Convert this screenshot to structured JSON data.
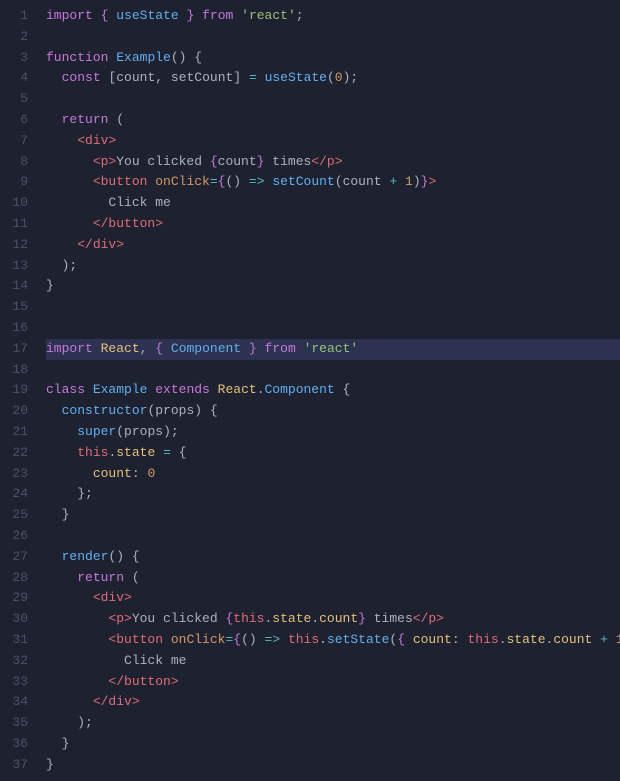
{
  "editor": {
    "background": "#1e2130",
    "highlighted_line": 17,
    "lines": [
      {
        "num": 1,
        "tokens": [
          {
            "type": "kw",
            "text": "import"
          },
          {
            "type": "plain",
            "text": " "
          },
          {
            "type": "brace",
            "text": "{"
          },
          {
            "type": "plain",
            "text": " "
          },
          {
            "type": "fn",
            "text": "useState"
          },
          {
            "type": "plain",
            "text": " "
          },
          {
            "type": "brace",
            "text": "}"
          },
          {
            "type": "plain",
            "text": " "
          },
          {
            "type": "from-kw",
            "text": "from"
          },
          {
            "type": "plain",
            "text": " "
          },
          {
            "type": "str",
            "text": "'react'"
          },
          {
            "type": "semi",
            "text": ";"
          }
        ]
      },
      {
        "num": 2,
        "tokens": []
      },
      {
        "num": 3,
        "tokens": [
          {
            "type": "kw",
            "text": "function"
          },
          {
            "type": "plain",
            "text": " "
          },
          {
            "type": "fn",
            "text": "Example"
          },
          {
            "type": "punct",
            "text": "() {"
          }
        ]
      },
      {
        "num": 4,
        "tokens": [
          {
            "type": "plain",
            "text": "  "
          },
          {
            "type": "kw",
            "text": "const"
          },
          {
            "type": "plain",
            "text": " "
          },
          {
            "type": "bracket",
            "text": "["
          },
          {
            "type": "plain",
            "text": "count"
          },
          {
            "type": "comma",
            "text": ","
          },
          {
            "type": "plain",
            "text": " "
          },
          {
            "type": "plain",
            "text": "setCount"
          },
          {
            "type": "bracket",
            "text": "]"
          },
          {
            "type": "plain",
            "text": " "
          },
          {
            "type": "operator",
            "text": "="
          },
          {
            "type": "plain",
            "text": " "
          },
          {
            "type": "fn",
            "text": "useState"
          },
          {
            "type": "paren",
            "text": "("
          },
          {
            "type": "num",
            "text": "0"
          },
          {
            "type": "paren",
            "text": ")"
          },
          {
            "type": "semi",
            "text": ";"
          }
        ]
      },
      {
        "num": 5,
        "tokens": []
      },
      {
        "num": 6,
        "tokens": [
          {
            "type": "plain",
            "text": "  "
          },
          {
            "type": "kw",
            "text": "return"
          },
          {
            "type": "plain",
            "text": " ("
          }
        ]
      },
      {
        "num": 7,
        "tokens": [
          {
            "type": "plain",
            "text": "    "
          },
          {
            "type": "jsx-tag",
            "text": "<div>"
          }
        ]
      },
      {
        "num": 8,
        "tokens": [
          {
            "type": "plain",
            "text": "      "
          },
          {
            "type": "jsx-tag",
            "text": "<p>"
          },
          {
            "type": "plain",
            "text": "You clicked "
          },
          {
            "type": "brace",
            "text": "{"
          },
          {
            "type": "plain",
            "text": "count"
          },
          {
            "type": "brace",
            "text": "}"
          },
          {
            "type": "plain",
            "text": " times"
          },
          {
            "type": "jsx-tag",
            "text": "</p>"
          }
        ]
      },
      {
        "num": 9,
        "tokens": [
          {
            "type": "plain",
            "text": "      "
          },
          {
            "type": "jsx-tag",
            "text": "<button"
          },
          {
            "type": "plain",
            "text": " "
          },
          {
            "type": "jsx-attr",
            "text": "onClick"
          },
          {
            "type": "operator",
            "text": "="
          },
          {
            "type": "brace",
            "text": "{"
          },
          {
            "type": "paren",
            "text": "("
          },
          {
            "type": "paren",
            "text": ")"
          },
          {
            "type": "plain",
            "text": " "
          },
          {
            "type": "arrow",
            "text": "=>"
          },
          {
            "type": "plain",
            "text": " "
          },
          {
            "type": "fn",
            "text": "setCount"
          },
          {
            "type": "paren",
            "text": "("
          },
          {
            "type": "plain",
            "text": "count "
          },
          {
            "type": "operator",
            "text": "+"
          },
          {
            "type": "plain",
            "text": " "
          },
          {
            "type": "num",
            "text": "1"
          },
          {
            "type": "paren",
            "text": ")"
          },
          {
            "type": "brace",
            "text": "}"
          },
          {
            "type": "jsx-tag",
            "text": ">"
          }
        ]
      },
      {
        "num": 10,
        "tokens": [
          {
            "type": "plain",
            "text": "        Click me"
          }
        ]
      },
      {
        "num": 11,
        "tokens": [
          {
            "type": "plain",
            "text": "      "
          },
          {
            "type": "jsx-tag",
            "text": "</button>"
          }
        ]
      },
      {
        "num": 12,
        "tokens": [
          {
            "type": "plain",
            "text": "    "
          },
          {
            "type": "jsx-tag",
            "text": "</div>"
          }
        ]
      },
      {
        "num": 13,
        "tokens": [
          {
            "type": "plain",
            "text": "  );"
          }
        ]
      },
      {
        "num": 14,
        "tokens": [
          {
            "type": "plain",
            "text": "}"
          }
        ]
      },
      {
        "num": 15,
        "tokens": []
      },
      {
        "num": 16,
        "tokens": []
      },
      {
        "num": 17,
        "tokens": [
          {
            "type": "kw",
            "text": "import"
          },
          {
            "type": "plain",
            "text": " "
          },
          {
            "type": "react-name",
            "text": "React"
          },
          {
            "type": "comma",
            "text": ","
          },
          {
            "type": "plain",
            "text": " "
          },
          {
            "type": "brace",
            "text": "{"
          },
          {
            "type": "plain",
            "text": " "
          },
          {
            "type": "fn",
            "text": "Component"
          },
          {
            "type": "plain",
            "text": " "
          },
          {
            "type": "brace",
            "text": "}"
          },
          {
            "type": "plain",
            "text": " "
          },
          {
            "type": "from-kw",
            "text": "from"
          },
          {
            "type": "plain",
            "text": " "
          },
          {
            "type": "str",
            "text": "'react'"
          }
        ],
        "highlighted": true
      },
      {
        "num": 18,
        "tokens": []
      },
      {
        "num": 19,
        "tokens": [
          {
            "type": "kw",
            "text": "class"
          },
          {
            "type": "plain",
            "text": " "
          },
          {
            "type": "fn",
            "text": "Example"
          },
          {
            "type": "plain",
            "text": " "
          },
          {
            "type": "kw",
            "text": "extends"
          },
          {
            "type": "plain",
            "text": " "
          },
          {
            "type": "react-name",
            "text": "React"
          },
          {
            "type": "punct",
            "text": "."
          },
          {
            "type": "fn",
            "text": "Component"
          },
          {
            "type": "plain",
            "text": " {"
          }
        ]
      },
      {
        "num": 20,
        "tokens": [
          {
            "type": "plain",
            "text": "  "
          },
          {
            "type": "fn",
            "text": "constructor"
          },
          {
            "type": "paren",
            "text": "("
          },
          {
            "type": "plain",
            "text": "props"
          },
          {
            "type": "paren",
            "text": ")"
          },
          {
            "type": "plain",
            "text": " {"
          }
        ]
      },
      {
        "num": 21,
        "tokens": [
          {
            "type": "plain",
            "text": "    "
          },
          {
            "type": "super-fn",
            "text": "super"
          },
          {
            "type": "paren",
            "text": "("
          },
          {
            "type": "plain",
            "text": "props"
          },
          {
            "type": "paren",
            "text": ")"
          },
          {
            "type": "semi",
            "text": ";"
          }
        ]
      },
      {
        "num": 22,
        "tokens": [
          {
            "type": "plain",
            "text": "    "
          },
          {
            "type": "this-kw",
            "text": "this"
          },
          {
            "type": "punct",
            "text": "."
          },
          {
            "type": "state-prop",
            "text": "state"
          },
          {
            "type": "plain",
            "text": " "
          },
          {
            "type": "operator",
            "text": "="
          },
          {
            "type": "plain",
            "text": " {"
          }
        ]
      },
      {
        "num": 23,
        "tokens": [
          {
            "type": "plain",
            "text": "      "
          },
          {
            "type": "state-prop",
            "text": "count"
          },
          {
            "type": "colon",
            "text": ":"
          },
          {
            "type": "plain",
            "text": " "
          },
          {
            "type": "num",
            "text": "0"
          }
        ]
      },
      {
        "num": 24,
        "tokens": [
          {
            "type": "plain",
            "text": "    };"
          }
        ]
      },
      {
        "num": 25,
        "tokens": [
          {
            "type": "plain",
            "text": "  }"
          }
        ]
      },
      {
        "num": 26,
        "tokens": []
      },
      {
        "num": 27,
        "tokens": [
          {
            "type": "plain",
            "text": "  "
          },
          {
            "type": "fn",
            "text": "render"
          },
          {
            "type": "paren",
            "text": "()"
          },
          {
            "type": "plain",
            "text": " {"
          }
        ]
      },
      {
        "num": 28,
        "tokens": [
          {
            "type": "plain",
            "text": "    "
          },
          {
            "type": "kw",
            "text": "return"
          },
          {
            "type": "plain",
            "text": " ("
          }
        ]
      },
      {
        "num": 29,
        "tokens": [
          {
            "type": "plain",
            "text": "      "
          },
          {
            "type": "jsx-tag",
            "text": "<div>"
          }
        ]
      },
      {
        "num": 30,
        "tokens": [
          {
            "type": "plain",
            "text": "        "
          },
          {
            "type": "jsx-tag",
            "text": "<p>"
          },
          {
            "type": "plain",
            "text": "You clicked "
          },
          {
            "type": "brace",
            "text": "{"
          },
          {
            "type": "this-kw",
            "text": "this"
          },
          {
            "type": "punct",
            "text": "."
          },
          {
            "type": "state-prop",
            "text": "state"
          },
          {
            "type": "punct",
            "text": "."
          },
          {
            "type": "state-prop",
            "text": "count"
          },
          {
            "type": "brace",
            "text": "}"
          },
          {
            "type": "plain",
            "text": " times"
          },
          {
            "type": "jsx-tag",
            "text": "</p>"
          }
        ]
      },
      {
        "num": 31,
        "tokens": [
          {
            "type": "plain",
            "text": "        "
          },
          {
            "type": "jsx-tag",
            "text": "<button"
          },
          {
            "type": "plain",
            "text": " "
          },
          {
            "type": "jsx-attr",
            "text": "onClick"
          },
          {
            "type": "operator",
            "text": "="
          },
          {
            "type": "brace",
            "text": "{"
          },
          {
            "type": "paren",
            "text": "("
          },
          {
            "type": "paren",
            "text": ")"
          },
          {
            "type": "plain",
            "text": " "
          },
          {
            "type": "arrow",
            "text": "=>"
          },
          {
            "type": "plain",
            "text": " "
          },
          {
            "type": "this-kw",
            "text": "this"
          },
          {
            "type": "punct",
            "text": "."
          },
          {
            "type": "method",
            "text": "setState"
          },
          {
            "type": "paren",
            "text": "("
          },
          {
            "type": "brace",
            "text": "{"
          },
          {
            "type": "plain",
            "text": " "
          },
          {
            "type": "state-prop",
            "text": "count"
          },
          {
            "type": "colon",
            "text": ":"
          },
          {
            "type": "plain",
            "text": " "
          },
          {
            "type": "this-kw",
            "text": "this"
          },
          {
            "type": "punct",
            "text": "."
          },
          {
            "type": "state-prop",
            "text": "state"
          },
          {
            "type": "punct",
            "text": "."
          },
          {
            "type": "state-prop",
            "text": "count"
          },
          {
            "type": "plain",
            "text": " "
          },
          {
            "type": "operator",
            "text": "+"
          },
          {
            "type": "plain",
            "text": " "
          },
          {
            "type": "num",
            "text": "1"
          },
          {
            "type": "plain",
            "text": " "
          },
          {
            "type": "brace",
            "text": "}"
          },
          {
            "type": "paren",
            "text": ")"
          },
          {
            "type": "brace",
            "text": "}"
          },
          {
            "type": "jsx-tag",
            "text": ">"
          }
        ]
      },
      {
        "num": 32,
        "tokens": [
          {
            "type": "plain",
            "text": "          Click me"
          }
        ]
      },
      {
        "num": 33,
        "tokens": [
          {
            "type": "plain",
            "text": "        "
          },
          {
            "type": "jsx-tag",
            "text": "</button>"
          }
        ]
      },
      {
        "num": 34,
        "tokens": [
          {
            "type": "plain",
            "text": "      "
          },
          {
            "type": "jsx-tag",
            "text": "</div>"
          }
        ]
      },
      {
        "num": 35,
        "tokens": [
          {
            "type": "plain",
            "text": "    );"
          }
        ]
      },
      {
        "num": 36,
        "tokens": [
          {
            "type": "plain",
            "text": "  }"
          }
        ]
      },
      {
        "num": 37,
        "tokens": [
          {
            "type": "plain",
            "text": "}"
          }
        ]
      }
    ]
  }
}
